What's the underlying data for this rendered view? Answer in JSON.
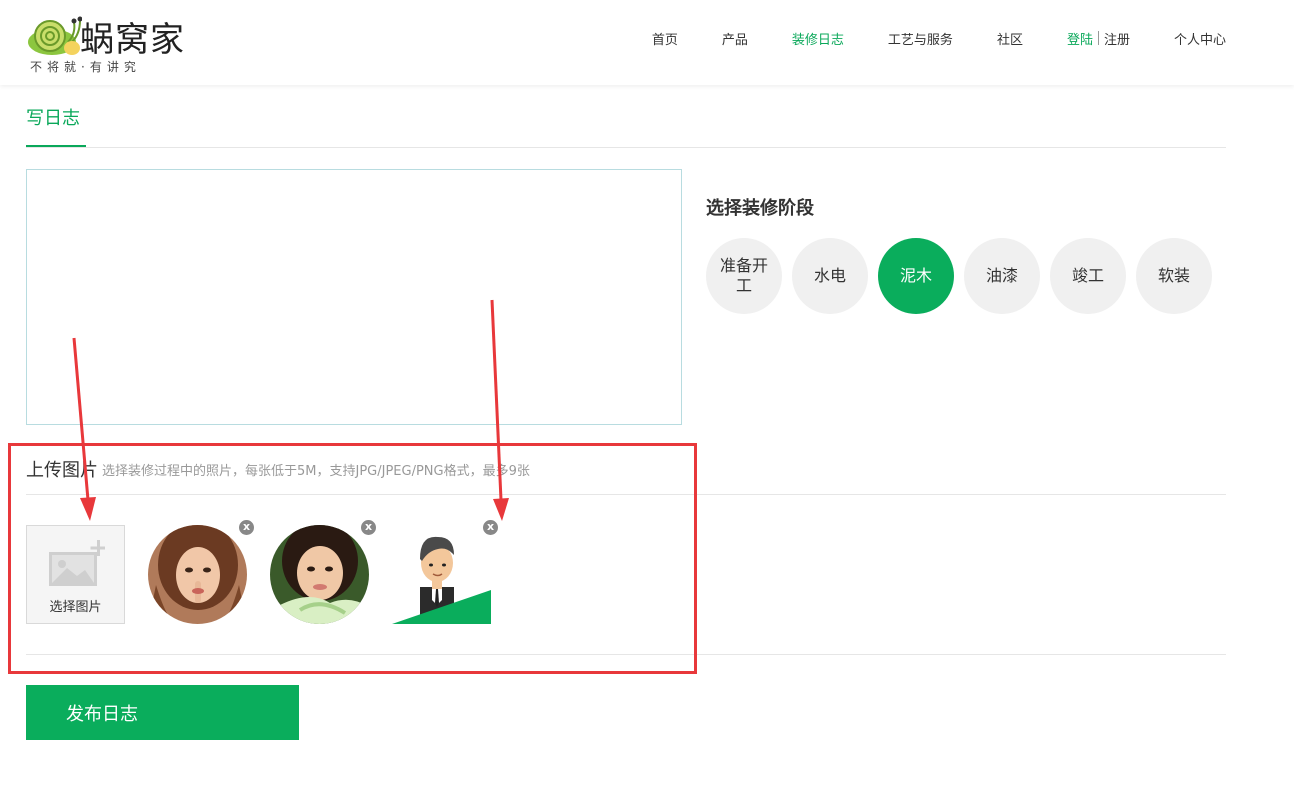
{
  "header": {
    "logo_text": "蜗窝家",
    "slogan": "不将就·有讲究",
    "nav": [
      {
        "label": "首页",
        "active": false
      },
      {
        "label": "产品",
        "active": false
      },
      {
        "label": "装修日志",
        "active": true
      },
      {
        "label": "工艺与服务",
        "active": false
      },
      {
        "label": "社区",
        "active": false
      }
    ],
    "login_label": "登陆",
    "register_label": "注册",
    "profile_label": "个人中心"
  },
  "tab": {
    "title": "写日志"
  },
  "editor": {
    "value": "",
    "placeholder": ""
  },
  "stage": {
    "title": "选择装修阶段",
    "options": [
      {
        "label": "准备开工",
        "active": false
      },
      {
        "label": "水电",
        "active": false
      },
      {
        "label": "泥木",
        "active": true
      },
      {
        "label": "油漆",
        "active": false
      },
      {
        "label": "竣工",
        "active": false
      },
      {
        "label": "软装",
        "active": false
      }
    ]
  },
  "upload": {
    "title": "上传图片",
    "hint": "选择装修过程中的照片，每张低于5M，支持JPG/JPEG/PNG格式，最多9张",
    "picker_label": "选择图片",
    "remove_label": "x"
  },
  "publish_label": "发布日志",
  "colors": {
    "accent": "#0aad5c",
    "annotation": "#e8383b"
  }
}
